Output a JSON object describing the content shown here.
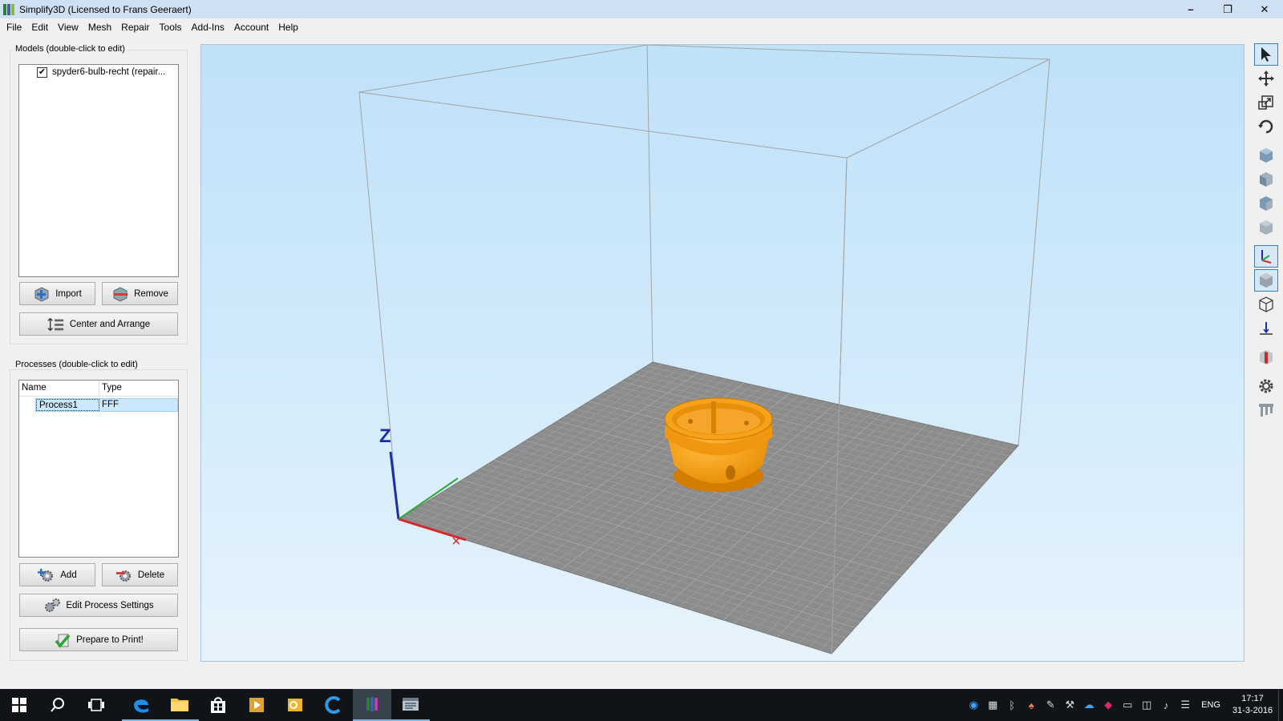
{
  "window": {
    "title": "Simplify3D (Licensed to Frans Geeraert)",
    "minimize": "–",
    "restore": "❐",
    "close": "✕"
  },
  "menu": [
    "File",
    "Edit",
    "View",
    "Mesh",
    "Repair",
    "Tools",
    "Add-Ins",
    "Account",
    "Help"
  ],
  "models": {
    "group_title": "Models (double-click to edit)",
    "items": [
      {
        "name": "spyder6-bulb-recht (repair...",
        "checked": true
      }
    ],
    "import_label": "Import",
    "remove_label": "Remove",
    "center_label": "Center and Arrange"
  },
  "processes": {
    "group_title": "Processes (double-click to edit)",
    "columns": [
      "Name",
      "Type"
    ],
    "rows": [
      {
        "name": "Process1",
        "type": "FFF"
      }
    ],
    "add_label": "Add",
    "delete_label": "Delete",
    "edit_label": "Edit Process Settings",
    "prepare_label": "Prepare to Print!"
  },
  "viewport": {
    "axis_z_label": "Z",
    "model_color": "#f7a21b",
    "bed_color": "#8a8a8a"
  },
  "right_toolbar": [
    "select-icon",
    "move-icon",
    "scale-icon",
    "rotate-icon",
    "view-iso-icon",
    "view-front-icon",
    "view-top-icon",
    "view-side-icon",
    "axes-toggle-icon",
    "solid-view-icon",
    "build-volume-icon",
    "ground-icon",
    "cross-section-icon",
    "settings-icon",
    "supports-icon"
  ],
  "taskbar": {
    "clock_time": "17:17",
    "clock_date": "31-3-2016",
    "language": "ENG"
  },
  "colors": {
    "accent": "#3c7fb1",
    "taskbar": "#101418",
    "titlebar": "#cfe0f2"
  }
}
